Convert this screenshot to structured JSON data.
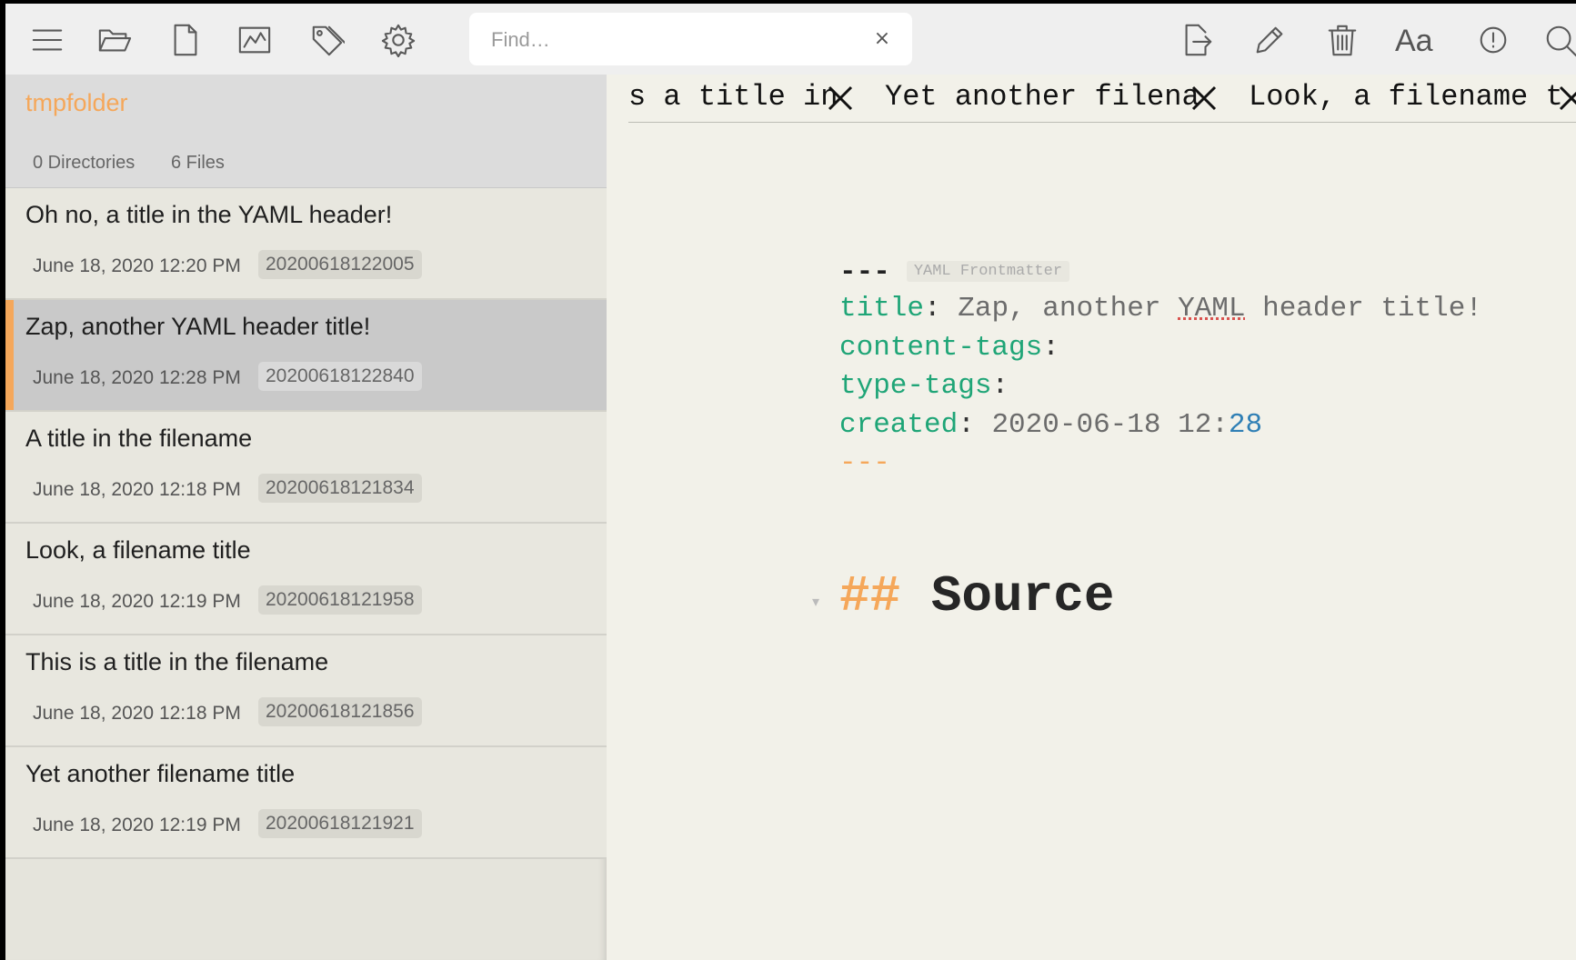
{
  "toolbar": {
    "search_placeholder": "Find…",
    "search_clear": "×",
    "font_button": "Aa",
    "icons": [
      "menu-icon",
      "folder-open-icon",
      "file-icon",
      "chart-icon",
      "tag-icon",
      "gear-icon",
      "export-icon",
      "pencil-icon",
      "trash-icon",
      "font-icon",
      "info-icon",
      "search-icon"
    ]
  },
  "sidebar": {
    "folder": "tmpfolder",
    "directories": "0 Directories",
    "files": "6 Files",
    "items": [
      {
        "title": "Oh no, a title in the YAML header!",
        "date": "June 18, 2020 12:20 PM",
        "id": "20200618122005"
      },
      {
        "title": "Zap, another YAML header title!",
        "date": "June 18, 2020 12:28 PM",
        "id": "20200618122840"
      },
      {
        "title": "A title in the filename",
        "date": "June 18, 2020 12:18 PM",
        "id": "20200618121834"
      },
      {
        "title": "Look, a filename title",
        "date": "June 18, 2020 12:19 PM",
        "id": "20200618121958"
      },
      {
        "title": "This is a title in the filename",
        "date": "June 18, 2020 12:18 PM",
        "id": "20200618121856"
      },
      {
        "title": "Yet another filename title",
        "date": "June 18, 2020 12:19 PM",
        "id": "20200618121921"
      }
    ]
  },
  "editor": {
    "tabs": [
      "s a title in",
      "Yet another filena",
      "Look, a filename t"
    ],
    "yaml": {
      "fence_open": "---",
      "badge": "YAML Frontmatter",
      "title_key": "title",
      "title_value_pre": "Zap, another ",
      "title_value_spell": "YAML",
      "title_value_post": " header title!",
      "content_tags_key": "content-tags",
      "type_tags_key": "type-tags",
      "created_key": "created",
      "created_value": "2020-06-18 12:",
      "created_minutes": "28",
      "fence_close": "---"
    },
    "heading_marker": "##",
    "heading_text": "Source",
    "fold_arrow": "▾"
  },
  "colors": {
    "accent": "#f5a75a",
    "yaml_key": "#1fa577",
    "number": "#2f7fb5"
  }
}
